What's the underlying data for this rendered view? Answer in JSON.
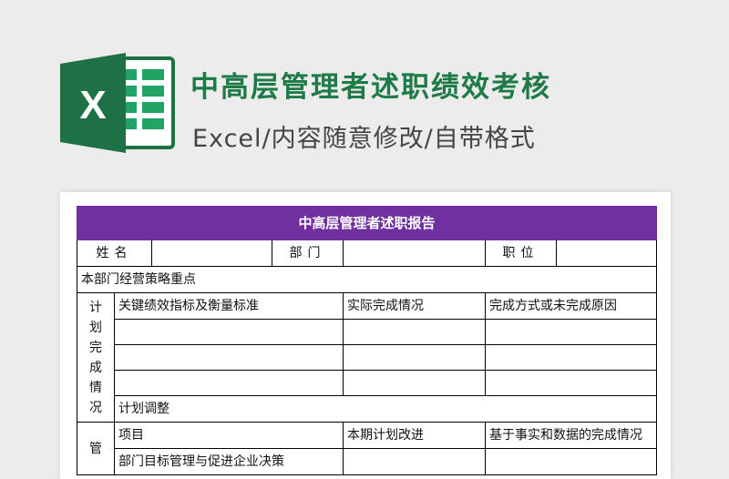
{
  "header": {
    "title": "中高层管理者述职绩效考核",
    "subtitle": "Excel/内容随意修改/自带格式",
    "logo_letter": "X",
    "logo_color": "#1e7145"
  },
  "form": {
    "title": "中高层管理者述职报告",
    "accent_color": "#7030a0",
    "name_label": "姓名",
    "dept_label": "部门",
    "position_label": "职位",
    "strategy_label": "本部门经营策略重点",
    "plan_section_label": "计划完成情况",
    "plan_headers": [
      "关键绩效指标及衡量标准",
      "实际完成情况",
      "完成方式或未完成原因"
    ],
    "plan_adjust_label": "计划调整",
    "mgmt_section_label": "管",
    "mgmt_headers": [
      "项目",
      "本期计划改进",
      "基于事实和数据的完成情况"
    ],
    "mgmt_row1": "部门目标管理与促进企业决策"
  }
}
